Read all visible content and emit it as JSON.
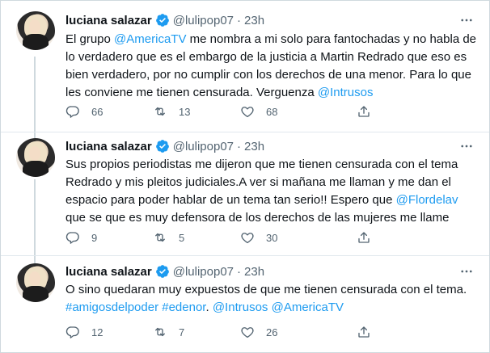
{
  "tweets": [
    {
      "name": "luciana salazar",
      "handle": "@lulipop07",
      "separator": "·",
      "time": "23h",
      "lines": [
        [
          {
            "t": "El grupo "
          },
          {
            "t": "@AmericaTV",
            "link": true
          },
          {
            "t": " me nombra a mi solo para fantochadas y no habla de"
          }
        ],
        [
          {
            "t": "lo  verdadero que es el embargo de la justicia a Martin Redrado que eso es"
          }
        ],
        [
          {
            "t": "bien verdadero, por no cumplir con los derechos de una menor. Para lo que"
          }
        ],
        [
          {
            "t": "les conviene me tienen censurada. Verguenza "
          },
          {
            "t": "@Intrusos",
            "link": true
          }
        ]
      ],
      "replies": "66",
      "retweets": "13",
      "likes": "68"
    },
    {
      "name": "luciana salazar",
      "handle": "@lulipop07",
      "separator": "·",
      "time": "23h",
      "lines": [
        [
          {
            "t": "Sus propios periodistas me dijeron que me tienen censurada con el tema"
          }
        ],
        [
          {
            "t": "Redrado y mis pleitos judiciales.A ver si mañana me llaman y me dan el"
          }
        ],
        [
          {
            "t": "espacio para poder hablar de un tema tan serio!! Espero que "
          },
          {
            "t": "@Flordelav",
            "link": true
          }
        ],
        [
          {
            "t": "que se que es muy defensora de los derechos de las mujeres me llame"
          }
        ]
      ],
      "replies": "9",
      "retweets": "5",
      "likes": "30"
    },
    {
      "name": "luciana salazar",
      "handle": "@lulipop07",
      "separator": "·",
      "time": "23h",
      "lines": [
        [
          {
            "t": "O sino quedaran muy expuestos de que me tienen censurada con el tema."
          }
        ],
        [
          {
            "t": "#amigosdelpoder",
            "link": true
          },
          {
            "t": " "
          },
          {
            "t": "#edenor",
            "link": true
          },
          {
            "t": ". "
          },
          {
            "t": "@Intrusos",
            "link": true
          },
          {
            "t": " "
          },
          {
            "t": "@AmericaTV",
            "link": true
          }
        ]
      ],
      "replies": "12",
      "retweets": "7",
      "likes": "26"
    }
  ],
  "colors": {
    "link": "#1d9bf0",
    "verified": "#1d9bf0",
    "secondary_text": "#536471",
    "thread_line": "#cfd9de"
  },
  "icons": [
    "verified-badge-icon",
    "more-icon",
    "reply-icon",
    "retweet-icon",
    "like-icon",
    "share-icon"
  ]
}
